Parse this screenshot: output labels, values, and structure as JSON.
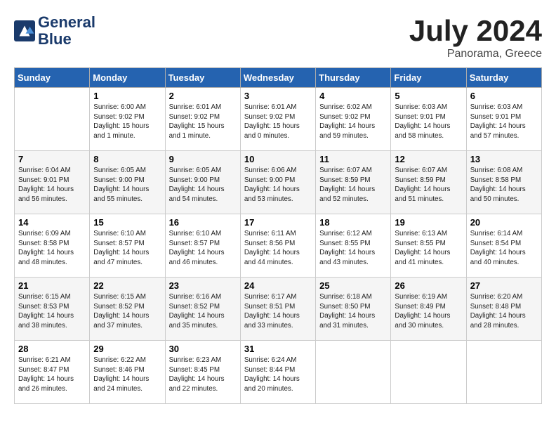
{
  "header": {
    "logo_line1": "General",
    "logo_line2": "Blue",
    "month": "July 2024",
    "location": "Panorama, Greece"
  },
  "weekdays": [
    "Sunday",
    "Monday",
    "Tuesday",
    "Wednesday",
    "Thursday",
    "Friday",
    "Saturday"
  ],
  "weeks": [
    [
      {
        "day": "",
        "info": ""
      },
      {
        "day": "1",
        "info": "Sunrise: 6:00 AM\nSunset: 9:02 PM\nDaylight: 15 hours\nand 1 minute."
      },
      {
        "day": "2",
        "info": "Sunrise: 6:01 AM\nSunset: 9:02 PM\nDaylight: 15 hours\nand 1 minute."
      },
      {
        "day": "3",
        "info": "Sunrise: 6:01 AM\nSunset: 9:02 PM\nDaylight: 15 hours\nand 0 minutes."
      },
      {
        "day": "4",
        "info": "Sunrise: 6:02 AM\nSunset: 9:02 PM\nDaylight: 14 hours\nand 59 minutes."
      },
      {
        "day": "5",
        "info": "Sunrise: 6:03 AM\nSunset: 9:01 PM\nDaylight: 14 hours\nand 58 minutes."
      },
      {
        "day": "6",
        "info": "Sunrise: 6:03 AM\nSunset: 9:01 PM\nDaylight: 14 hours\nand 57 minutes."
      }
    ],
    [
      {
        "day": "7",
        "info": "Sunrise: 6:04 AM\nSunset: 9:01 PM\nDaylight: 14 hours\nand 56 minutes."
      },
      {
        "day": "8",
        "info": "Sunrise: 6:05 AM\nSunset: 9:00 PM\nDaylight: 14 hours\nand 55 minutes."
      },
      {
        "day": "9",
        "info": "Sunrise: 6:05 AM\nSunset: 9:00 PM\nDaylight: 14 hours\nand 54 minutes."
      },
      {
        "day": "10",
        "info": "Sunrise: 6:06 AM\nSunset: 9:00 PM\nDaylight: 14 hours\nand 53 minutes."
      },
      {
        "day": "11",
        "info": "Sunrise: 6:07 AM\nSunset: 8:59 PM\nDaylight: 14 hours\nand 52 minutes."
      },
      {
        "day": "12",
        "info": "Sunrise: 6:07 AM\nSunset: 8:59 PM\nDaylight: 14 hours\nand 51 minutes."
      },
      {
        "day": "13",
        "info": "Sunrise: 6:08 AM\nSunset: 8:58 PM\nDaylight: 14 hours\nand 50 minutes."
      }
    ],
    [
      {
        "day": "14",
        "info": "Sunrise: 6:09 AM\nSunset: 8:58 PM\nDaylight: 14 hours\nand 48 minutes."
      },
      {
        "day": "15",
        "info": "Sunrise: 6:10 AM\nSunset: 8:57 PM\nDaylight: 14 hours\nand 47 minutes."
      },
      {
        "day": "16",
        "info": "Sunrise: 6:10 AM\nSunset: 8:57 PM\nDaylight: 14 hours\nand 46 minutes."
      },
      {
        "day": "17",
        "info": "Sunrise: 6:11 AM\nSunset: 8:56 PM\nDaylight: 14 hours\nand 44 minutes."
      },
      {
        "day": "18",
        "info": "Sunrise: 6:12 AM\nSunset: 8:55 PM\nDaylight: 14 hours\nand 43 minutes."
      },
      {
        "day": "19",
        "info": "Sunrise: 6:13 AM\nSunset: 8:55 PM\nDaylight: 14 hours\nand 41 minutes."
      },
      {
        "day": "20",
        "info": "Sunrise: 6:14 AM\nSunset: 8:54 PM\nDaylight: 14 hours\nand 40 minutes."
      }
    ],
    [
      {
        "day": "21",
        "info": "Sunrise: 6:15 AM\nSunset: 8:53 PM\nDaylight: 14 hours\nand 38 minutes."
      },
      {
        "day": "22",
        "info": "Sunrise: 6:15 AM\nSunset: 8:52 PM\nDaylight: 14 hours\nand 37 minutes."
      },
      {
        "day": "23",
        "info": "Sunrise: 6:16 AM\nSunset: 8:52 PM\nDaylight: 14 hours\nand 35 minutes."
      },
      {
        "day": "24",
        "info": "Sunrise: 6:17 AM\nSunset: 8:51 PM\nDaylight: 14 hours\nand 33 minutes."
      },
      {
        "day": "25",
        "info": "Sunrise: 6:18 AM\nSunset: 8:50 PM\nDaylight: 14 hours\nand 31 minutes."
      },
      {
        "day": "26",
        "info": "Sunrise: 6:19 AM\nSunset: 8:49 PM\nDaylight: 14 hours\nand 30 minutes."
      },
      {
        "day": "27",
        "info": "Sunrise: 6:20 AM\nSunset: 8:48 PM\nDaylight: 14 hours\nand 28 minutes."
      }
    ],
    [
      {
        "day": "28",
        "info": "Sunrise: 6:21 AM\nSunset: 8:47 PM\nDaylight: 14 hours\nand 26 minutes."
      },
      {
        "day": "29",
        "info": "Sunrise: 6:22 AM\nSunset: 8:46 PM\nDaylight: 14 hours\nand 24 minutes."
      },
      {
        "day": "30",
        "info": "Sunrise: 6:23 AM\nSunset: 8:45 PM\nDaylight: 14 hours\nand 22 minutes."
      },
      {
        "day": "31",
        "info": "Sunrise: 6:24 AM\nSunset: 8:44 PM\nDaylight: 14 hours\nand 20 minutes."
      },
      {
        "day": "",
        "info": ""
      },
      {
        "day": "",
        "info": ""
      },
      {
        "day": "",
        "info": ""
      }
    ]
  ]
}
